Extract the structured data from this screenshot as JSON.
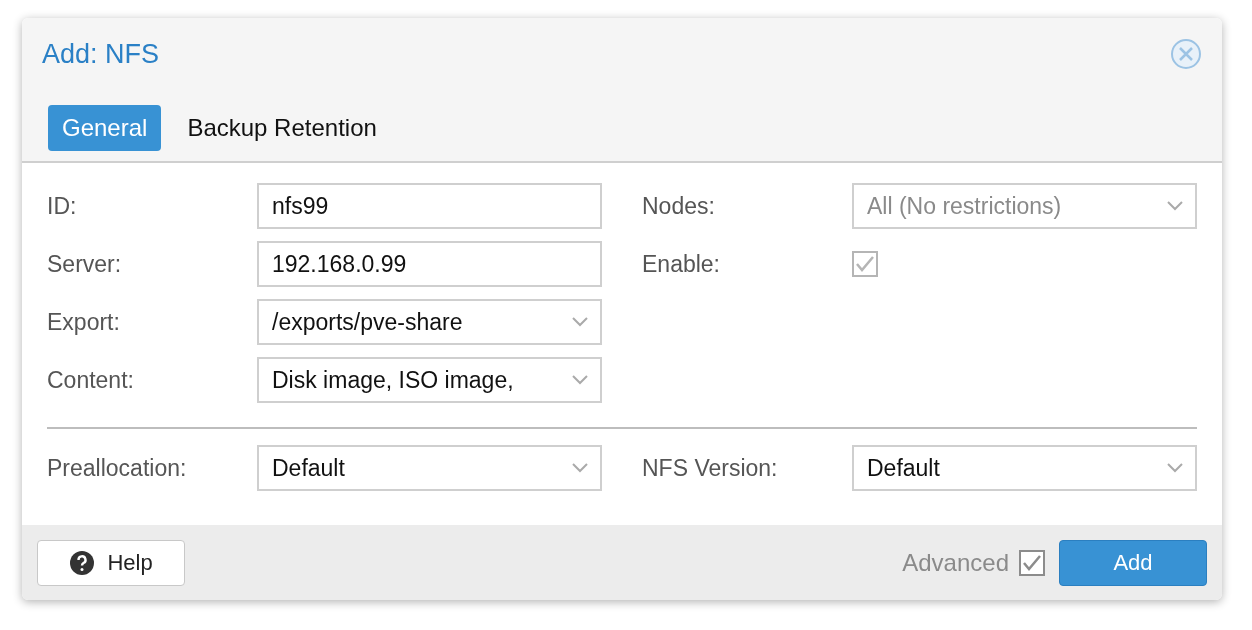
{
  "dialog": {
    "title": "Add: NFS"
  },
  "tabs": [
    {
      "label": "General",
      "selected": true
    },
    {
      "label": "Backup Retention",
      "selected": false
    }
  ],
  "left_fields": [
    {
      "label": "ID:",
      "kind": "text",
      "value": "nfs99"
    },
    {
      "label": "Server:",
      "kind": "text",
      "value": "192.168.0.99"
    },
    {
      "label": "Export:",
      "kind": "combo",
      "value": "/exports/pve-share"
    },
    {
      "label": "Content:",
      "kind": "combo",
      "value": "Disk image, ISO image,"
    }
  ],
  "right_fields": [
    {
      "label": "Nodes:",
      "kind": "combo",
      "value": "All (No restrictions)",
      "disabled": true
    },
    {
      "label": "Enable:",
      "kind": "checkbox",
      "checked": true,
      "disabled": true
    }
  ],
  "advanced_fields": [
    {
      "label": "Preallocation:",
      "kind": "combo",
      "value": "Default"
    },
    {
      "label": "NFS Version:",
      "kind": "combo",
      "value": "Default"
    }
  ],
  "footer": {
    "help_button": "Help",
    "advanced": {
      "label": "Advanced",
      "checked": true
    },
    "add_button": "Add"
  }
}
